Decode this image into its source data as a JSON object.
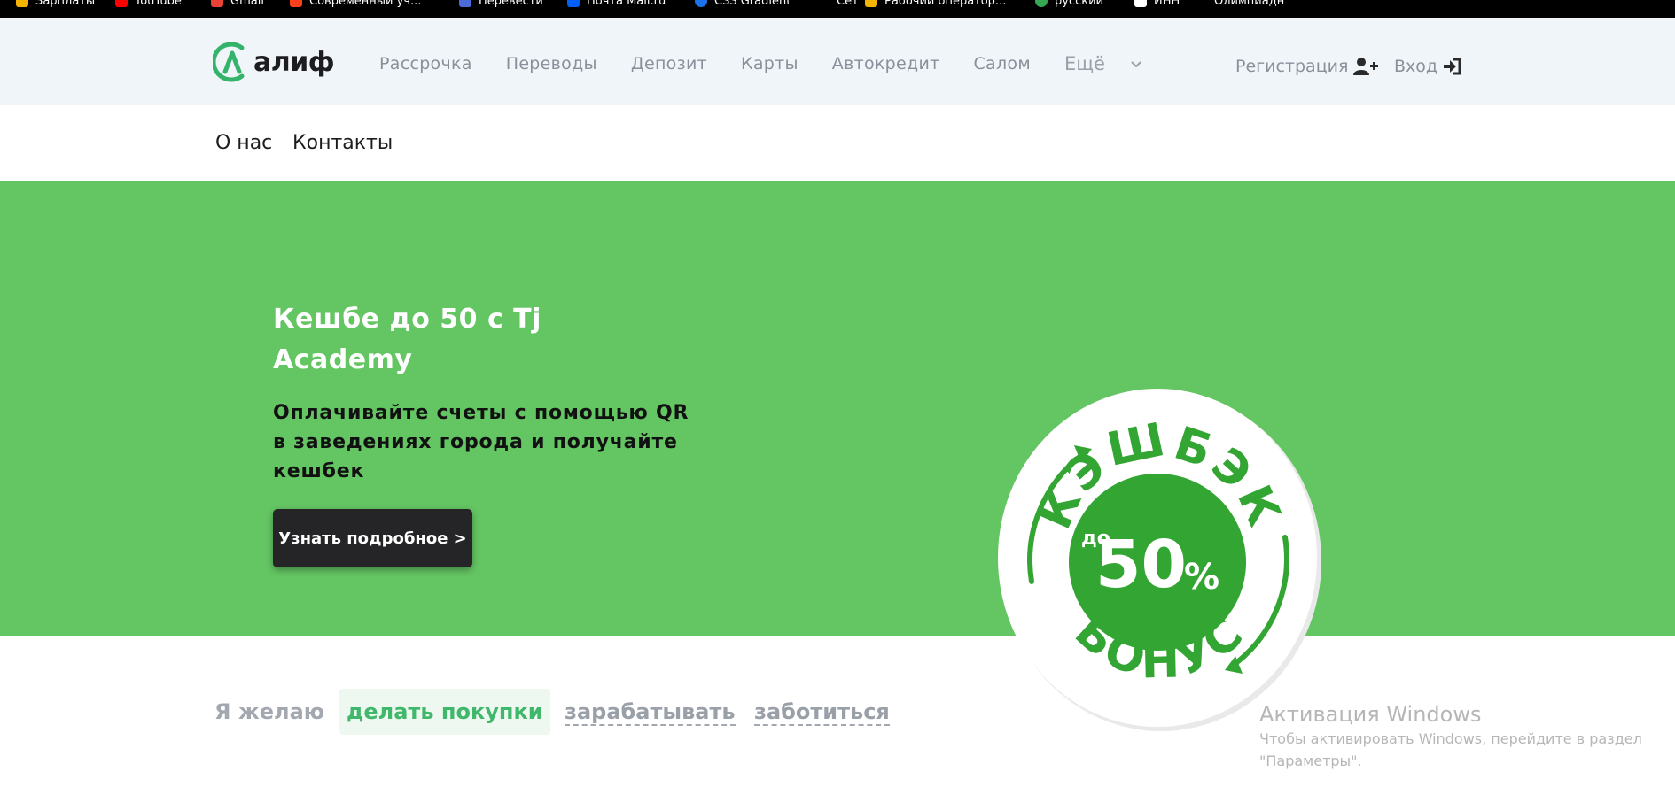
{
  "bookmarks": [
    {
      "label": "Зарплаты",
      "color": "#f4b400"
    },
    {
      "label": "YouTube",
      "color": "#ff0000"
    },
    {
      "label": "Gmail",
      "color": "#ea4335"
    },
    {
      "label": "Современный уч...",
      "color": "#fc3f1d"
    },
    {
      "label": "Перевести",
      "color": "#4a6bd8"
    },
    {
      "label": "Почта Mail.ru",
      "color": "#005ff9"
    },
    {
      "label": "CSS Gradient",
      "color": "#1a73e8"
    },
    {
      "label": "Сет",
      "color": "#888888"
    },
    {
      "label": "Рабочий оператор...",
      "color": "#f4b400"
    },
    {
      "label": "русский",
      "color": "#34a853"
    },
    {
      "label": "ИНН",
      "color": "#ffffff"
    },
    {
      "label": "Олимпиадн",
      "color": "#aaaaaa"
    }
  ],
  "logo": {
    "text": "алиф",
    "color": "#34b36a"
  },
  "nav": {
    "items": [
      "Рассрочка",
      "Переводы",
      "Депозит",
      "Карты",
      "Автокредит",
      "Салом"
    ],
    "more_label": "Ещё",
    "register_label": "Регистрация",
    "login_label": "Вход",
    "icons": {
      "register": "user-plus-icon",
      "login": "sign-in-icon",
      "more": "chevron-down-icon"
    }
  },
  "subnav": {
    "items": [
      "О нас",
      "Контакты"
    ]
  },
  "hero": {
    "title": "Кешбе до 50 с Tj Academy",
    "subtitle": "Оплачивайте счеты с помощью QR в заведениях города и получайте кешбек",
    "button_label": "Узнать подробное >",
    "background": "#64c563",
    "badge": {
      "top_text": "КЭШБЭК",
      "bottom_text": "БОНУС",
      "prefix": "до",
      "value": "50",
      "unit": "%",
      "green": "#33a532"
    }
  },
  "wishes": {
    "label": "Я желаю",
    "options": [
      "делать покупки",
      "зарабатывать",
      "заботиться"
    ],
    "active_index": 0,
    "accent": "#3fb86b"
  },
  "watermark": {
    "title": "Активация Windows",
    "text": "Чтобы активировать Windows, перейдите в раздел \"Параметры\"."
  }
}
